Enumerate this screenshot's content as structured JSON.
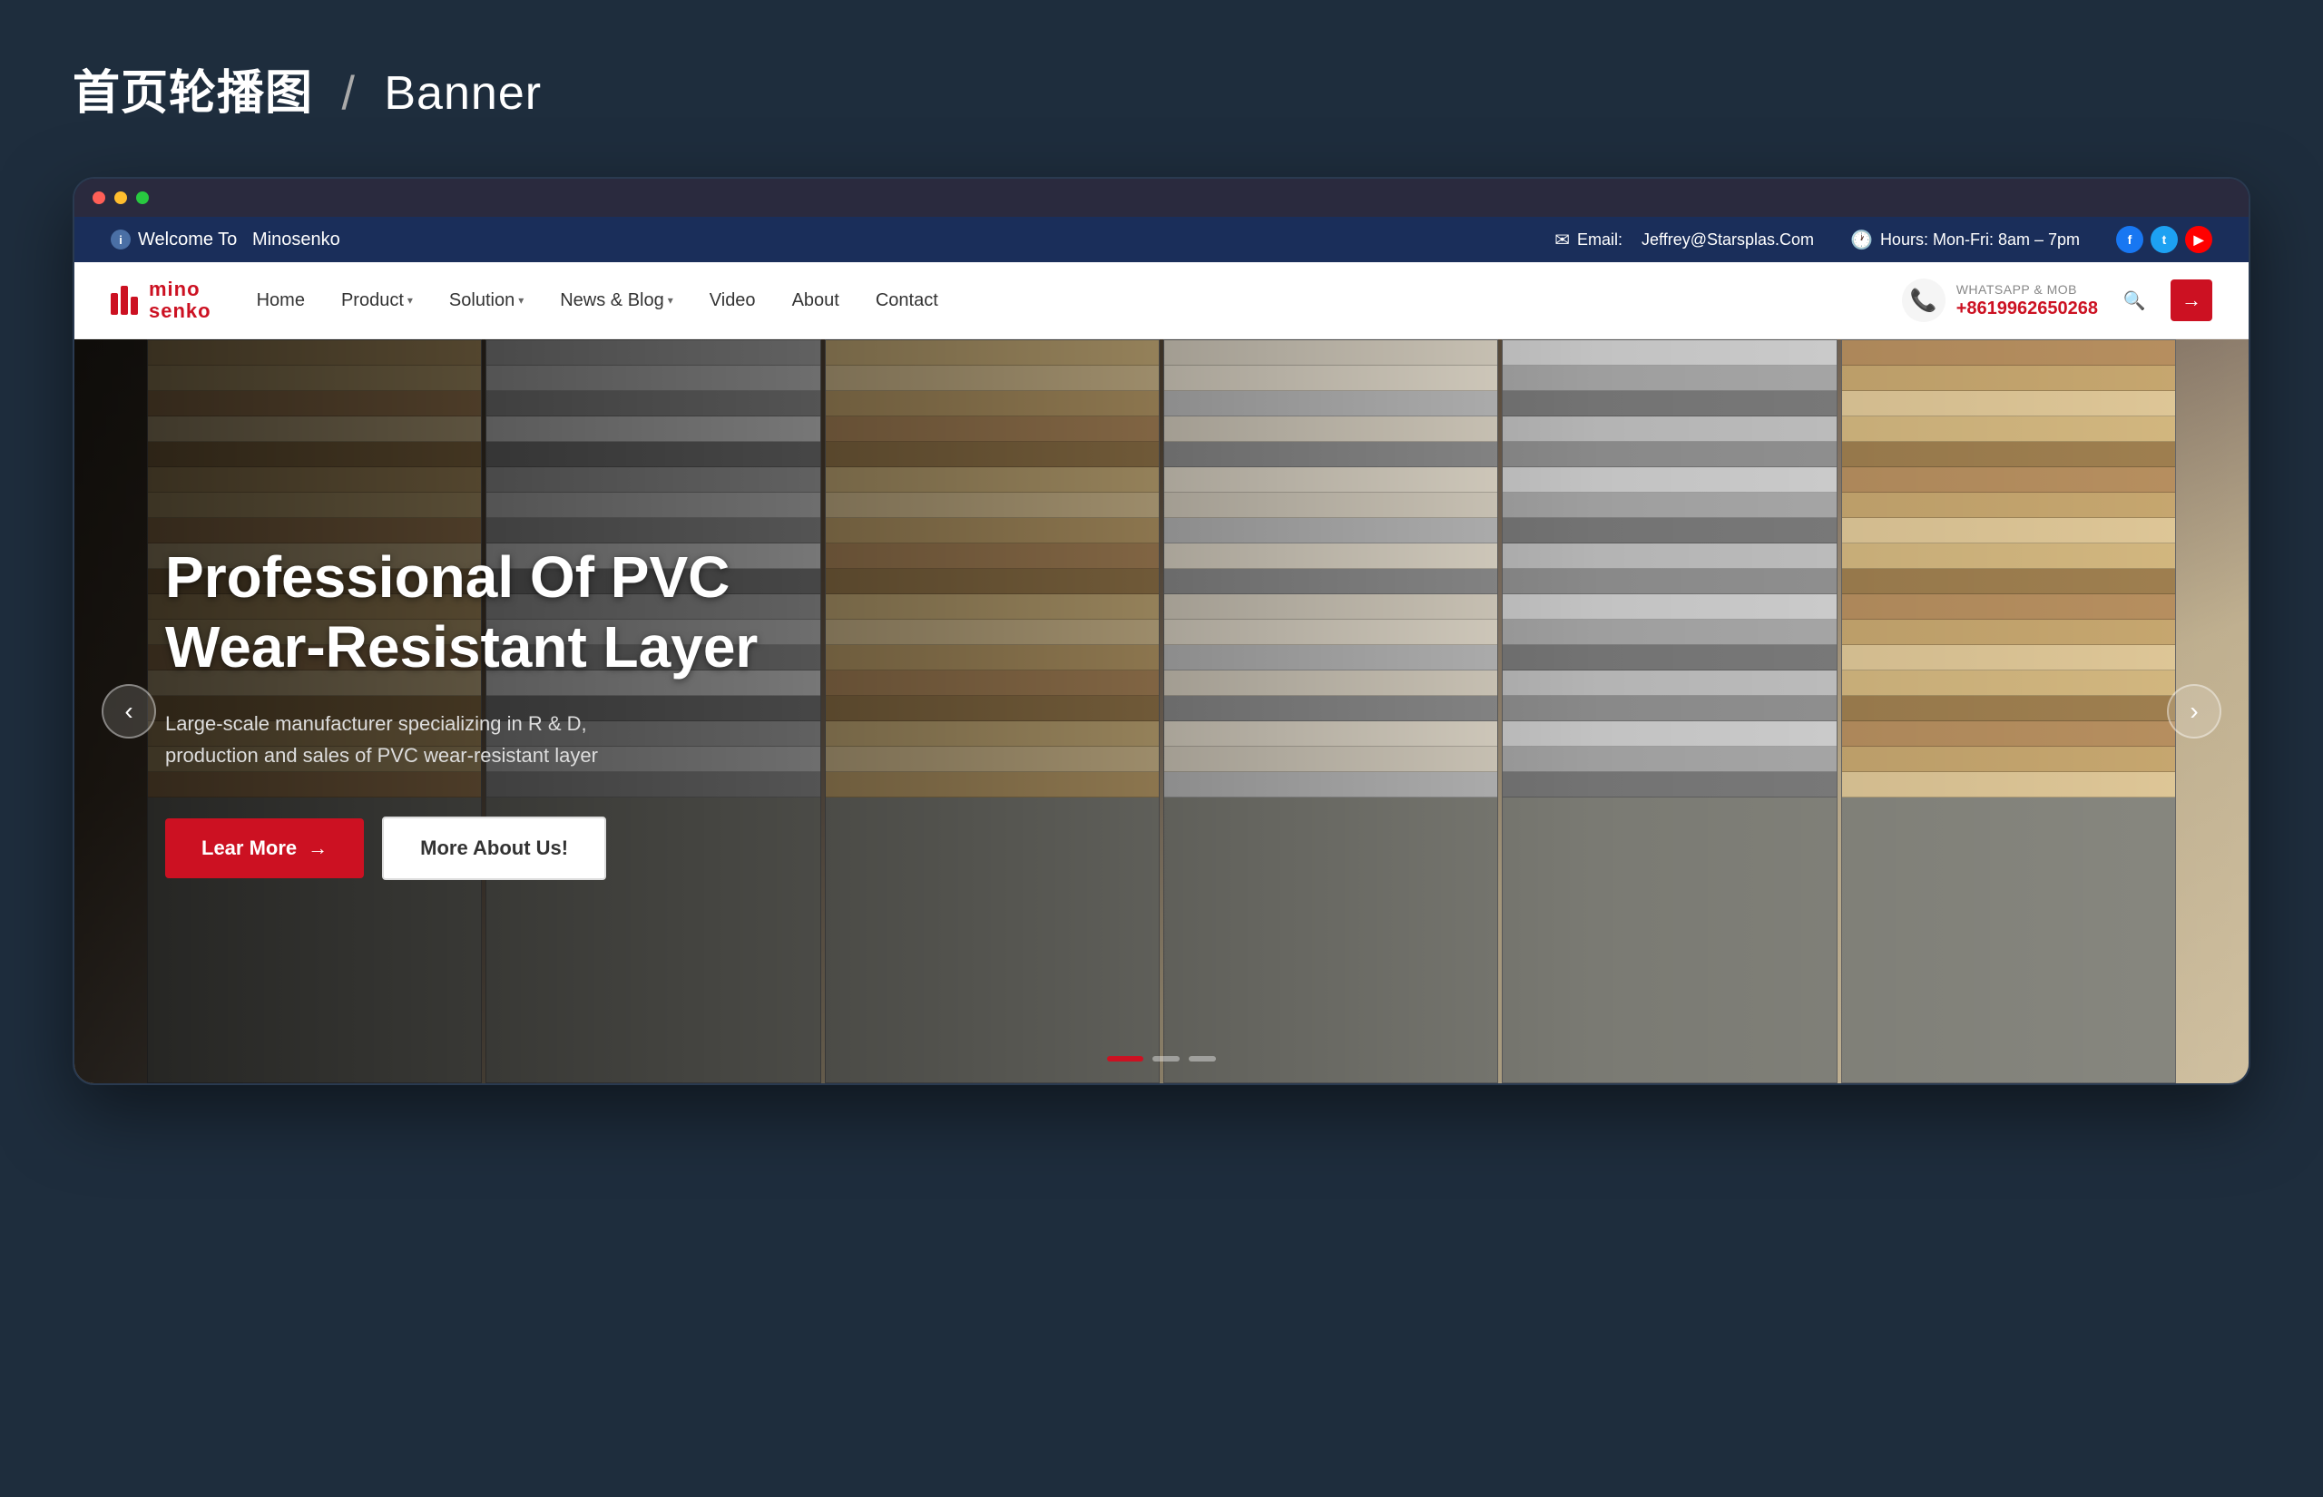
{
  "page": {
    "title_zh": "首页轮播图",
    "title_en": "Banner"
  },
  "topbar": {
    "welcome_label": "Welcome To",
    "welcome_brand": "Minosenko",
    "email_label": "Email:",
    "email_value": "Jeffrey@Starsplas.Com",
    "hours_label": "Hours: Mon-Fri: 8am – 7pm"
  },
  "navbar": {
    "logo_top": "mino",
    "logo_bottom": "senko",
    "menu": [
      {
        "label": "Home",
        "has_dropdown": false
      },
      {
        "label": "Product",
        "has_dropdown": true
      },
      {
        "label": "Solution",
        "has_dropdown": true
      },
      {
        "label": "News & Blog",
        "has_dropdown": true
      },
      {
        "label": "Video",
        "has_dropdown": false
      },
      {
        "label": "About",
        "has_dropdown": false
      },
      {
        "label": "Contact",
        "has_dropdown": false
      }
    ],
    "whatsapp_label": "WHATSAPP & MOB",
    "whatsapp_number": "+8619962650268",
    "cta_arrow": "→",
    "search_icon": "🔍"
  },
  "hero": {
    "title": "Professional Of PVC Wear-Resistant Layer",
    "description": "Large-scale manufacturer specializing in R & D, production and sales of PVC wear-resistant layer",
    "btn_primary": "Lear More",
    "btn_secondary": "More About Us!",
    "arrow_prev": "‹",
    "arrow_next": "›",
    "dots": [
      {
        "active": true
      },
      {
        "active": false
      },
      {
        "active": false
      }
    ]
  },
  "social": {
    "facebook": "f",
    "twitter": "t",
    "youtube": "▶"
  }
}
